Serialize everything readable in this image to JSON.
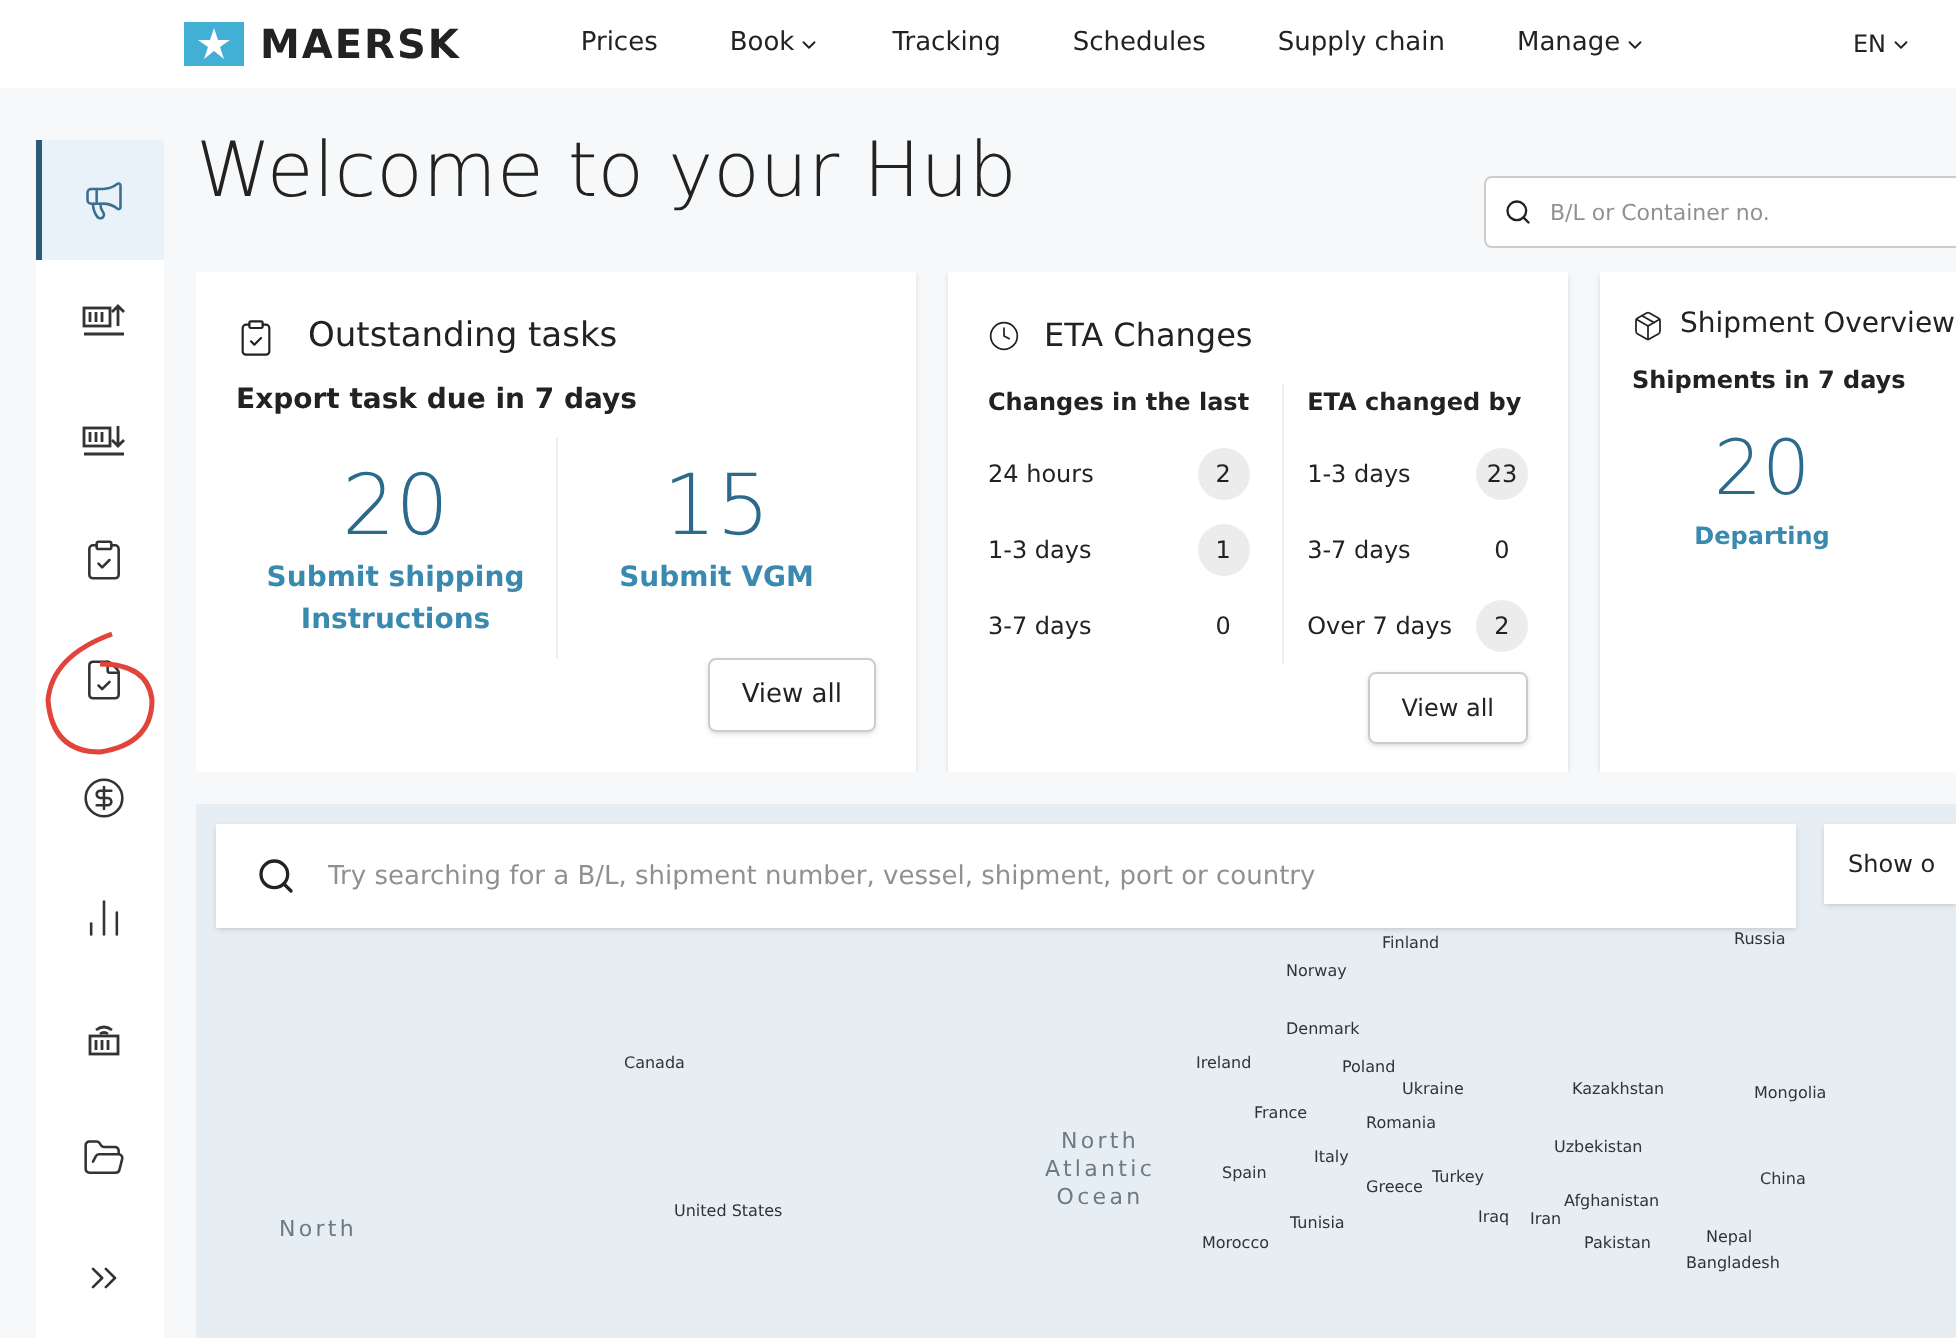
{
  "header": {
    "logo": "MAERSK",
    "nav": [
      {
        "label": "Prices",
        "dropdown": false
      },
      {
        "label": "Book",
        "dropdown": true
      },
      {
        "label": "Tracking",
        "dropdown": false
      },
      {
        "label": "Schedules",
        "dropdown": false
      },
      {
        "label": "Supply chain",
        "dropdown": false
      },
      {
        "label": "Manage",
        "dropdown": true
      }
    ],
    "language": "EN"
  },
  "sidebar": {
    "items": [
      {
        "selected": true
      },
      {
        "selected": false
      },
      {
        "selected": false
      },
      {
        "selected": false
      },
      {
        "selected": false
      },
      {
        "selected": false
      },
      {
        "selected": false
      },
      {
        "selected": false
      },
      {
        "selected": false
      },
      {
        "selected": false
      }
    ]
  },
  "page": {
    "title": "Welcome to your Hub",
    "search": {
      "placeholder": "B/L or Container no."
    }
  },
  "outstanding_tasks": {
    "title": "Outstanding tasks",
    "subtitle": "Export task due in 7 days",
    "stats": [
      {
        "value": "20",
        "label": "Submit shipping Instructions"
      },
      {
        "value": "15",
        "label": "Submit VGM"
      }
    ],
    "button": "View all"
  },
  "eta_changes": {
    "title": "ETA Changes",
    "columns": [
      {
        "heading": "Changes in the last",
        "rows": [
          {
            "label": "24 hours",
            "count": "2",
            "badge": true
          },
          {
            "label": "1-3 days",
            "count": "1",
            "badge": true
          },
          {
            "label": "3-7 days",
            "count": "0",
            "badge": false
          }
        ]
      },
      {
        "heading": "ETA changed by",
        "rows": [
          {
            "label": "1-3 days",
            "count": "23",
            "badge": true
          },
          {
            "label": "3-7 days",
            "count": "0",
            "badge": false
          },
          {
            "label": "Over 7 days",
            "count": "2",
            "badge": true
          }
        ]
      }
    ],
    "button": "View all"
  },
  "shipment_overview": {
    "title": "Shipment Overview",
    "subtitle": "Shipments in 7 days",
    "stats": [
      {
        "value": "20",
        "label": "Departing"
      }
    ]
  },
  "map": {
    "search": {
      "placeholder": "Try searching for a B/L, shipment number, vessel, shipment, port or country"
    },
    "button": "Show o",
    "labels": [
      {
        "text": "Finland",
        "kind": "country"
      },
      {
        "text": "Russia",
        "kind": "country"
      },
      {
        "text": "Norway",
        "kind": "country"
      },
      {
        "text": "Denmark",
        "kind": "country"
      },
      {
        "text": "Canada",
        "kind": "country"
      },
      {
        "text": "Ireland",
        "kind": "country"
      },
      {
        "text": "Poland",
        "kind": "country"
      },
      {
        "text": "Ukraine",
        "kind": "country"
      },
      {
        "text": "Kazakhstan",
        "kind": "country"
      },
      {
        "text": "Mongolia",
        "kind": "country"
      },
      {
        "text": "France",
        "kind": "country"
      },
      {
        "text": "Romania",
        "kind": "country"
      },
      {
        "text": "Uzbekistan",
        "kind": "country"
      },
      {
        "text": "North Atlantic Ocean",
        "kind": "ocean"
      },
      {
        "text": "Spain",
        "kind": "country"
      },
      {
        "text": "Italy",
        "kind": "country"
      },
      {
        "text": "Greece",
        "kind": "country"
      },
      {
        "text": "Turkey",
        "kind": "country"
      },
      {
        "text": "China",
        "kind": "country"
      },
      {
        "text": "United States",
        "kind": "country"
      },
      {
        "text": "Tunisia",
        "kind": "country"
      },
      {
        "text": "Iraq",
        "kind": "country"
      },
      {
        "text": "Iran",
        "kind": "country"
      },
      {
        "text": "Afghanistan",
        "kind": "country"
      },
      {
        "text": "Morocco",
        "kind": "country"
      },
      {
        "text": "Pakistan",
        "kind": "country"
      },
      {
        "text": "Nepal",
        "kind": "country"
      },
      {
        "text": "Bangladesh",
        "kind": "country"
      },
      {
        "text": "North",
        "kind": "ocean"
      }
    ]
  }
}
